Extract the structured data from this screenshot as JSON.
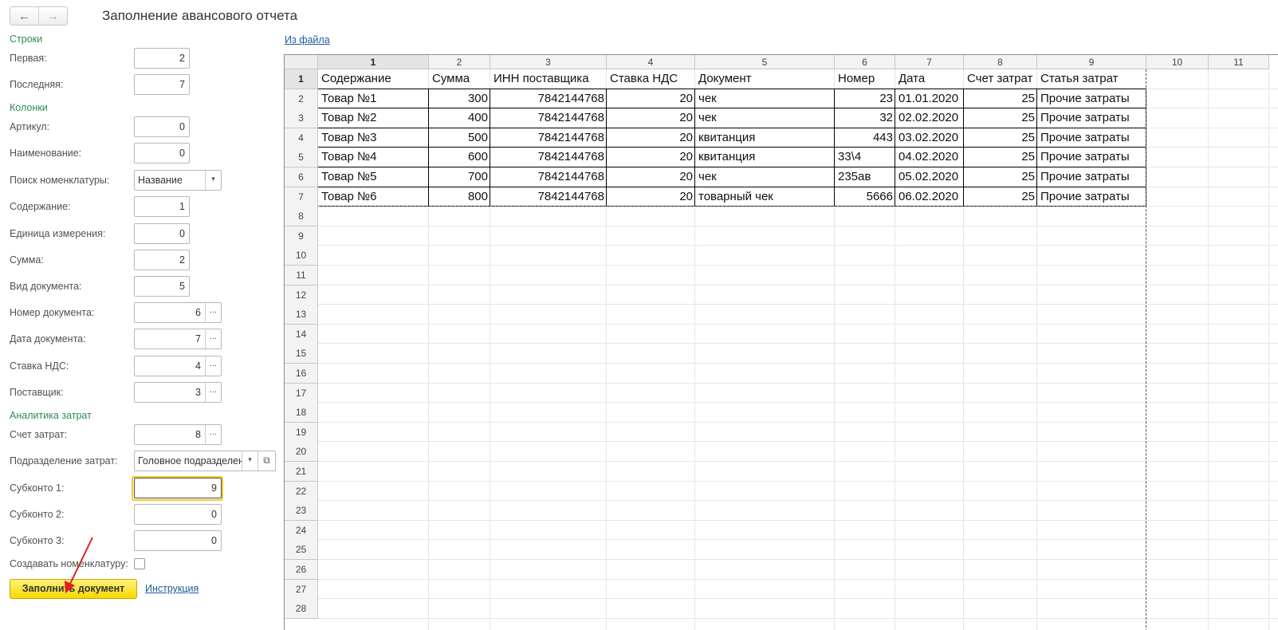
{
  "header": {
    "title": "Заполнение авансового отчета",
    "back_icon": "←",
    "forward_icon": "→",
    "from_file_link": "Из файла"
  },
  "form": {
    "rows_group": "Строки",
    "first_label": "Первая:",
    "first_value": "2",
    "last_label": "Последняя:",
    "last_value": "7",
    "columns_group": "Колонки",
    "article_label": "Артикул:",
    "article_value": "0",
    "name_label": "Наименование:",
    "name_value": "0",
    "nomen_search_label": "Поиск номенклатуры:",
    "nomen_search_value": "Название",
    "content_label": "Содержание:",
    "content_value": "1",
    "unit_label": "Единица измерения:",
    "unit_value": "0",
    "sum_label": "Сумма:",
    "sum_value": "2",
    "doc_type_label": "Вид документа:",
    "doc_type_value": "5",
    "doc_number_label": "Номер документа:",
    "doc_number_value": "6",
    "doc_date_label": "Дата документа:",
    "doc_date_value": "7",
    "vat_label": "Ставка НДС:",
    "vat_value": "4",
    "supplier_label": "Поставщик:",
    "supplier_value": "3",
    "analytics_group": "Аналитика затрат",
    "cost_account_label": "Счет затрат:",
    "cost_account_value": "8",
    "cost_division_label": "Подразделение затрат:",
    "cost_division_value": "Головное подразделение",
    "subconto1_label": "Субконто 1:",
    "subconto1_value": "9",
    "subconto2_label": "Субконто 2:",
    "subconto2_value": "0",
    "subconto3_label": "Субконто 3:",
    "subconto3_value": "0",
    "create_nomen_label": "Создавать номенклатуру:",
    "create_nomen_checked": false,
    "fill_button": "Заполнить документ",
    "instruction_link": "Инструкция",
    "pick_glyph": "...",
    "dropdown_glyph": "▾",
    "open_glyph": "⧉"
  },
  "sheet": {
    "column_headers": [
      "1",
      "2",
      "3",
      "4",
      "5",
      "6",
      "7",
      "8",
      "9",
      "10",
      "11"
    ],
    "row_headers": [
      "1",
      "2",
      "3",
      "4",
      "5",
      "6",
      "7",
      "8",
      "9",
      "10",
      "11",
      "12",
      "13",
      "14",
      "15",
      "16",
      "17",
      "18",
      "19",
      "20",
      "21",
      "22",
      "23",
      "24",
      "25",
      "26",
      "27",
      "28"
    ],
    "rows": [
      [
        "Содержание",
        "Сумма",
        "ИНН поставщика",
        "Ставка НДС",
        "Документ",
        "Номер",
        "Дата",
        "Счет затрат",
        "Статья затрат"
      ],
      [
        "Товар №1",
        "300",
        "7842144768",
        "20",
        "чек",
        "23",
        "01.01.2020",
        "25",
        "Прочие затраты"
      ],
      [
        "Товар №2",
        "400",
        "7842144768",
        "20",
        "чек",
        "32",
        "02.02.2020",
        "25",
        "Прочие затраты"
      ],
      [
        "Товар №3",
        "500",
        "7842144768",
        "20",
        "квитанция",
        "443",
        "03.02.2020",
        "25",
        "Прочие затраты"
      ],
      [
        "Товар №4",
        "600",
        "7842144768",
        "20",
        "квитанция",
        "33\\4",
        "04.02.2020",
        "25",
        "Прочие затраты"
      ],
      [
        "Товар №5",
        "700",
        "7842144768",
        "20",
        "чек",
        "235ав",
        "05.02.2020",
        "25",
        "Прочие затраты"
      ],
      [
        "Товар №6",
        "800",
        "7842144768",
        "20",
        "товарный чек",
        "5666",
        "06.02.2020",
        "25",
        "Прочие затраты"
      ]
    ]
  },
  "colors": {
    "group_title": "#2f8a52",
    "link": "#1f5aa0",
    "primary_button": "#f6d800",
    "focus_border": "#f6cc28",
    "annotation_arrow": "#e02020"
  }
}
